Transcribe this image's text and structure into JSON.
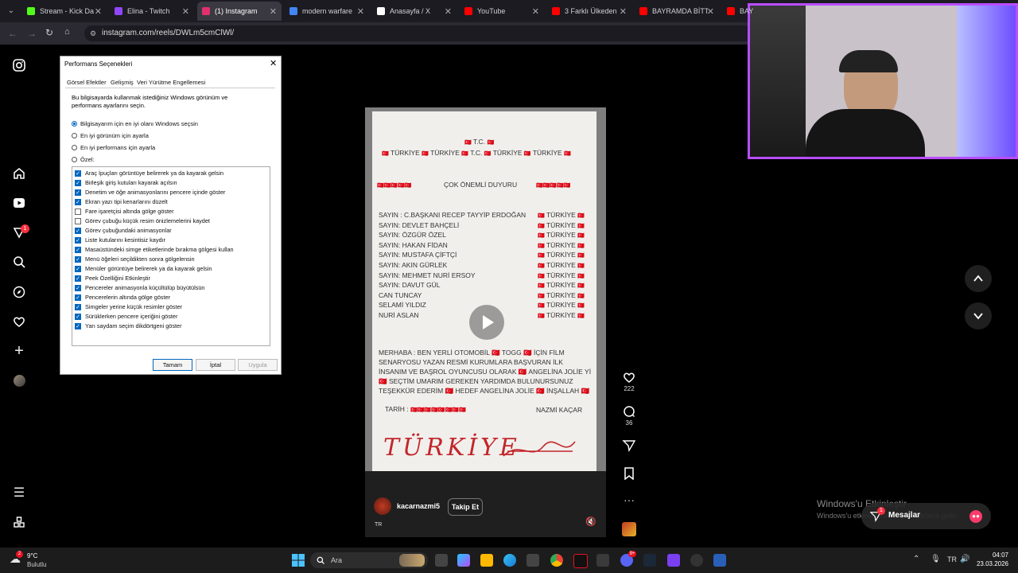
{
  "browser": {
    "tabs": [
      {
        "title": "Stream - Kick Da",
        "color": "#53fc18"
      },
      {
        "title": "Elina - Twitch",
        "color": "#9146ff"
      },
      {
        "title": "(1) Instagram",
        "color": "#e1306c",
        "active": true
      },
      {
        "title": "modern warfare",
        "color": "#4285f4"
      },
      {
        "title": "Anasayfa / X",
        "color": "#ffffff"
      },
      {
        "title": "YouTube",
        "color": "#ff0000"
      },
      {
        "title": "3 Farklı Ülkeden",
        "color": "#ff0000"
      },
      {
        "title": "BAYRAMDA BİTTİ",
        "color": "#ff0000"
      },
      {
        "title": "BAY",
        "color": "#ff0000"
      }
    ],
    "url": "instagram.com/reels/DWLm5cmClWl/"
  },
  "instagram": {
    "notification_badge": "1",
    "reel": {
      "paper": {
        "header": "T.C.",
        "turkiye": "TÜRKİYE",
        "title": "ÇOK ÖNEMLİ DUYURU",
        "names": [
          "SAYIN : C.BAŞKANI RECEP TAYYİP ERDOĞAN",
          "SAYIN: DEVLET BAHÇELİ",
          "SAYIN: ÖZGÜR ÖZEL",
          "SAYIN: HAKAN FİDAN",
          "SAYIN: MUSTAFA ÇİFTÇİ",
          "SAYIN: AKIN GÜRLEK",
          "SAYIN: MEHMET NURİ ERSOY",
          "SAYIN: DAVUT GÜL",
          "CAN TUNCAY",
          "SELAMİ YILDIZ",
          "NURİ ASLAN"
        ],
        "message": [
          "MERHABA : BEN YERLİ OTOMOBİL 🇹🇷 TOGG 🇹🇷 İÇİN FİLM",
          "SENARYOSU YAZAN RESMİ KURUMLARA BAŞVURAN İLK",
          "İNSANIM VE BAŞROL OYUNCUSU OLARAK 🇹🇷 ANGELİNA JOLİE Yİ",
          "🇹🇷 SEÇTİM UMARIM GEREKEN YARDIMDA BULUNURSUNUZ",
          "TEŞEKKÜR EDERİM 🇹🇷 HEDEF ANGELİNA JOLİE 🇹🇷 İNŞALLAH 🇹🇷"
        ],
        "date_label": "TARİH :",
        "signature": "NAZMİ KAÇAR",
        "handwriting": "TÜRKİYE"
      },
      "username": "kacarnazmi5",
      "follow_label": "Takip Et",
      "audio_label": "TR",
      "likes": "222",
      "comments": "36"
    },
    "watermark": {
      "title": "Windows'u Etkinleştir",
      "subtitle": "Windows'u etkinleştirmek için Ayarlar'a gidin."
    },
    "messages_label": "Mesajlar",
    "messages_badge": "1"
  },
  "dialog": {
    "title": "Performans Seçenekleri",
    "tabs": [
      "Görsel Efektler",
      "Gelişmiş",
      "Veri Yürütme Engellemesi"
    ],
    "description": "Bu bilgisayarda kullanmak istediğiniz Windows görünüm ve performans ayarlarını seçin.",
    "radios": [
      {
        "label": "Bilgisayarım için en iyi olanı Windows seçsin",
        "checked": true
      },
      {
        "label": "En iyi görünüm için ayarla",
        "checked": false
      },
      {
        "label": "En iyi performans için ayarla",
        "checked": false
      },
      {
        "label": "Özel:",
        "checked": false
      }
    ],
    "options": [
      {
        "label": "Araç İpuçları görüntüye belirerek ya da kayarak gelsin",
        "checked": true
      },
      {
        "label": "Birleşik giriş kutuları kayarak açılsın",
        "checked": true
      },
      {
        "label": "Denetim ve öğe animasyonlarını pencere içinde göster",
        "checked": true
      },
      {
        "label": "Ekran yazı tipi kenarlarını düzelt",
        "checked": true
      },
      {
        "label": "Fare işaretçisi altında gölge göster",
        "checked": false
      },
      {
        "label": "Görev çubuğu küçük resim önizlemelerini kaydet",
        "checked": false
      },
      {
        "label": "Görev çubuğundaki animasyonlar",
        "checked": true
      },
      {
        "label": "Liste kutularını kesintisiz kaydır",
        "checked": true
      },
      {
        "label": "Masaüstündeki simge etiketlerinde bırakma gölgesi kullan",
        "checked": true
      },
      {
        "label": "Menü öğeleri seçildikten sonra gölgelensin",
        "checked": true
      },
      {
        "label": "Menüler görüntüye belirerek ya da kayarak gelsin",
        "checked": true
      },
      {
        "label": "Peek Özelliğini Etkinleştir",
        "checked": true
      },
      {
        "label": "Pencereler animasyonla küçültülüp büyütülsün",
        "checked": true
      },
      {
        "label": "Pencerelerin altında gölge göster",
        "checked": true
      },
      {
        "label": "Simgeler yerine küçük resimler göster",
        "checked": true
      },
      {
        "label": "Sürüklerken pencere içeriğini göster",
        "checked": true
      },
      {
        "label": "Yarı saydam seçim dikdörtgeni göster",
        "checked": true
      }
    ],
    "buttons": {
      "ok": "Tamam",
      "cancel": "İptal",
      "apply": "Uygula"
    }
  },
  "taskbar": {
    "weather_temp": "9°C",
    "weather_desc": "Bulutlu",
    "weather_badge": "2",
    "search_placeholder": "Ara",
    "lang": "TR",
    "time": "04:07",
    "date": "23.03.2026",
    "discord_badge": "9+"
  }
}
